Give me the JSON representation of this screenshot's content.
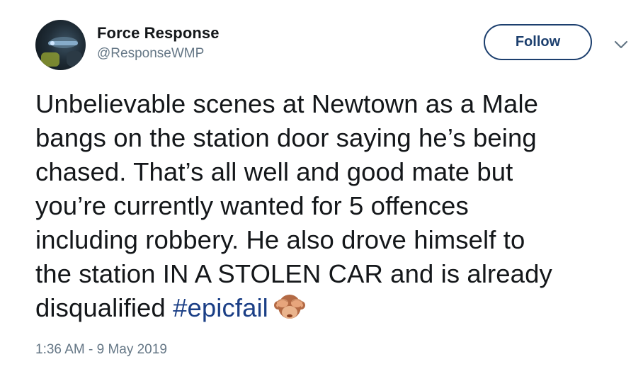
{
  "author": {
    "display_name": "Force Response",
    "handle": "@ResponseWMP"
  },
  "follow_label": "Follow",
  "tweet": {
    "lines": [
      "Unbelievable scenes at Newtown as a Male",
      "bangs on the station door saying he’s being",
      "chased. That’s all well and good mate but",
      "you’re currently wanted for 5 offences",
      "including robbery. He also drove himself to",
      "the station IN A STOLEN CAR and is already"
    ],
    "last_line_prefix": "disqualified ",
    "hashtag": "#epicfail",
    "emoji": "see-no-evil-monkey"
  },
  "timestamp": "1:36 AM - 9 May 2019",
  "colors": {
    "text": "#14171a",
    "secondary": "#657786",
    "link": "#1b3f86",
    "follow_border": "#1c3f6e"
  },
  "icons": {
    "menu": "chevron-down-icon"
  }
}
